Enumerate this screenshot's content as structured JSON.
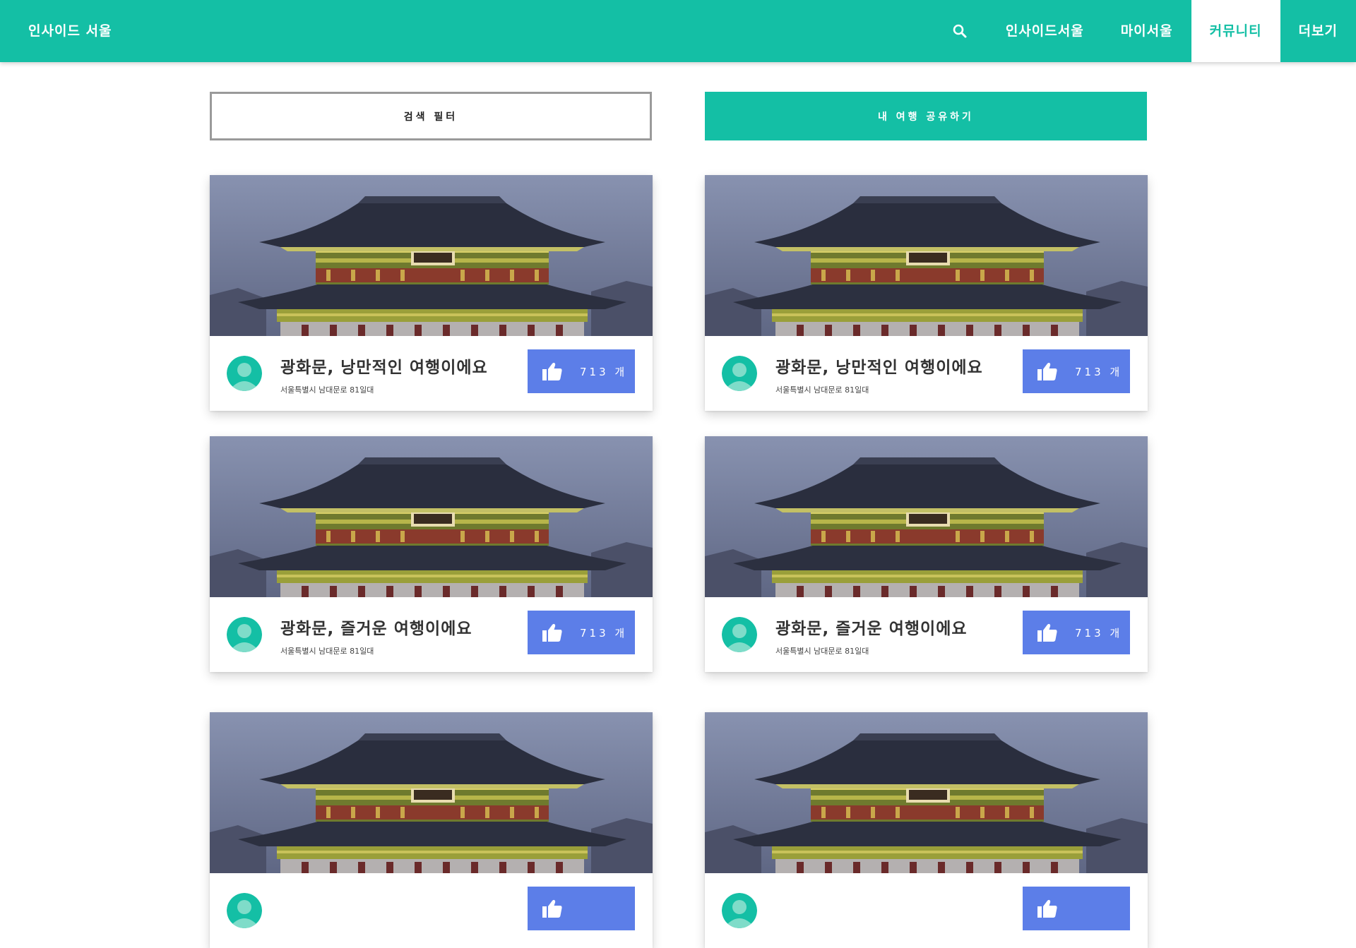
{
  "header": {
    "brand": "인사이드 서울",
    "nav": [
      {
        "label": "인사이드서울",
        "active": false
      },
      {
        "label": "마이서울",
        "active": false
      },
      {
        "label": "커뮤니티",
        "active": true
      },
      {
        "label": "더보기",
        "active": false
      }
    ],
    "search_icon": "search-icon",
    "color": "#14bfa5"
  },
  "actions": {
    "filter_label": "검색 필터",
    "share_label": "내 여행 공유하기"
  },
  "cards": [
    {
      "title": "광화문, 낭만적인 여행이에요",
      "address": "서울특별시 남대문로 81일대",
      "likes": "713 개"
    },
    {
      "title": "광화문, 낭만적인 여행이에요",
      "address": "서울특별시 남대문로 81일대",
      "likes": "713 개"
    },
    {
      "title": "광화문, 즐거운 여행이에요",
      "address": "서울특별시 남대문로 81일대",
      "likes": "713 개"
    },
    {
      "title": "광화문, 즐거운 여행이에요",
      "address": "서울특별시 남대문로 81일대",
      "likes": "713 개"
    },
    {
      "title": "",
      "address": "",
      "likes": ""
    },
    {
      "title": "",
      "address": "",
      "likes": ""
    }
  ],
  "colors": {
    "accent": "#14bfa5",
    "like_button": "#5c7ee8"
  }
}
